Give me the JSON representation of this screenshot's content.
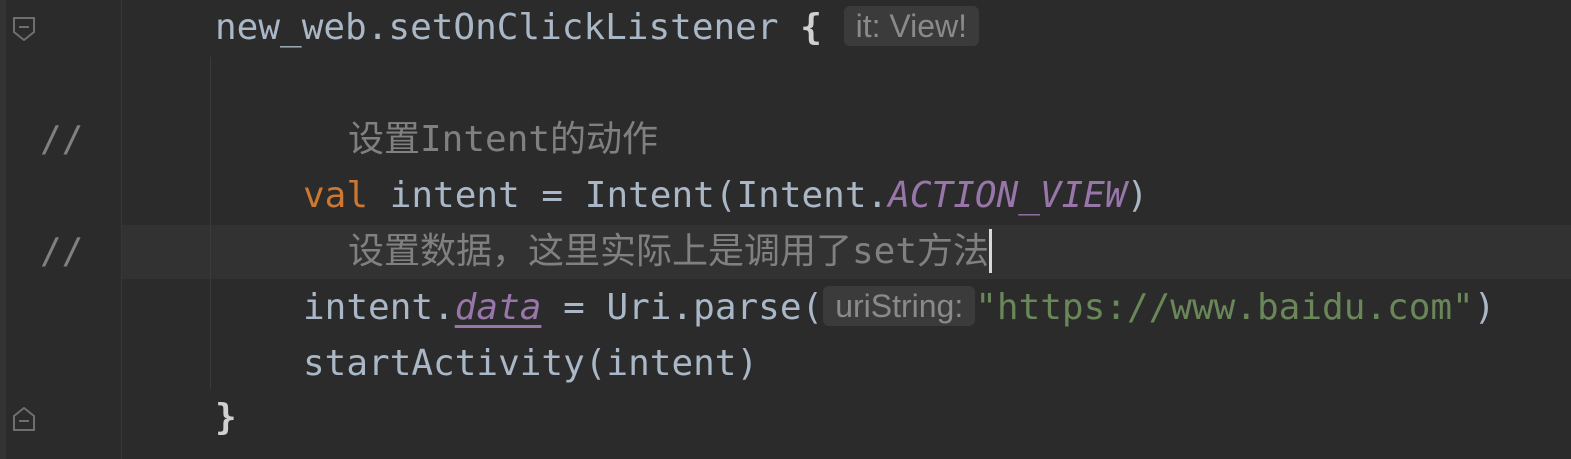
{
  "editor": {
    "lines": {
      "l1": {
        "receiver": "new_web.setOnClickListener",
        "brace": "{",
        "hint": "it: View!"
      },
      "l2": {
        "marker": "//",
        "comment": "设置Intent的动作"
      },
      "l3": {
        "keyword": "val",
        "text_a": " intent = Intent(Intent.",
        "constant": "ACTION_VIEW",
        "text_b": ")"
      },
      "l4": {
        "marker": "//",
        "comment": "设置数据，这里实际上是调用了set方法"
      },
      "l5": {
        "text_a": "intent.",
        "property": "data",
        "text_b": " = Uri.parse(",
        "hint": "uriString:",
        "string": "\"https://www.baidu.com\"",
        "text_c": ")"
      },
      "l6": {
        "text": "startActivity(intent)"
      },
      "l7": {
        "brace": "}"
      }
    },
    "colors": {
      "background": "#2b2b2b",
      "keyword": "#cc7832",
      "identifier": "#a9b7c6",
      "constant": "#9876aa",
      "string": "#6a8759",
      "comment": "#808080",
      "current_line": "#323232"
    },
    "icons": [
      "fold-start-icon",
      "fold-end-icon"
    ]
  }
}
